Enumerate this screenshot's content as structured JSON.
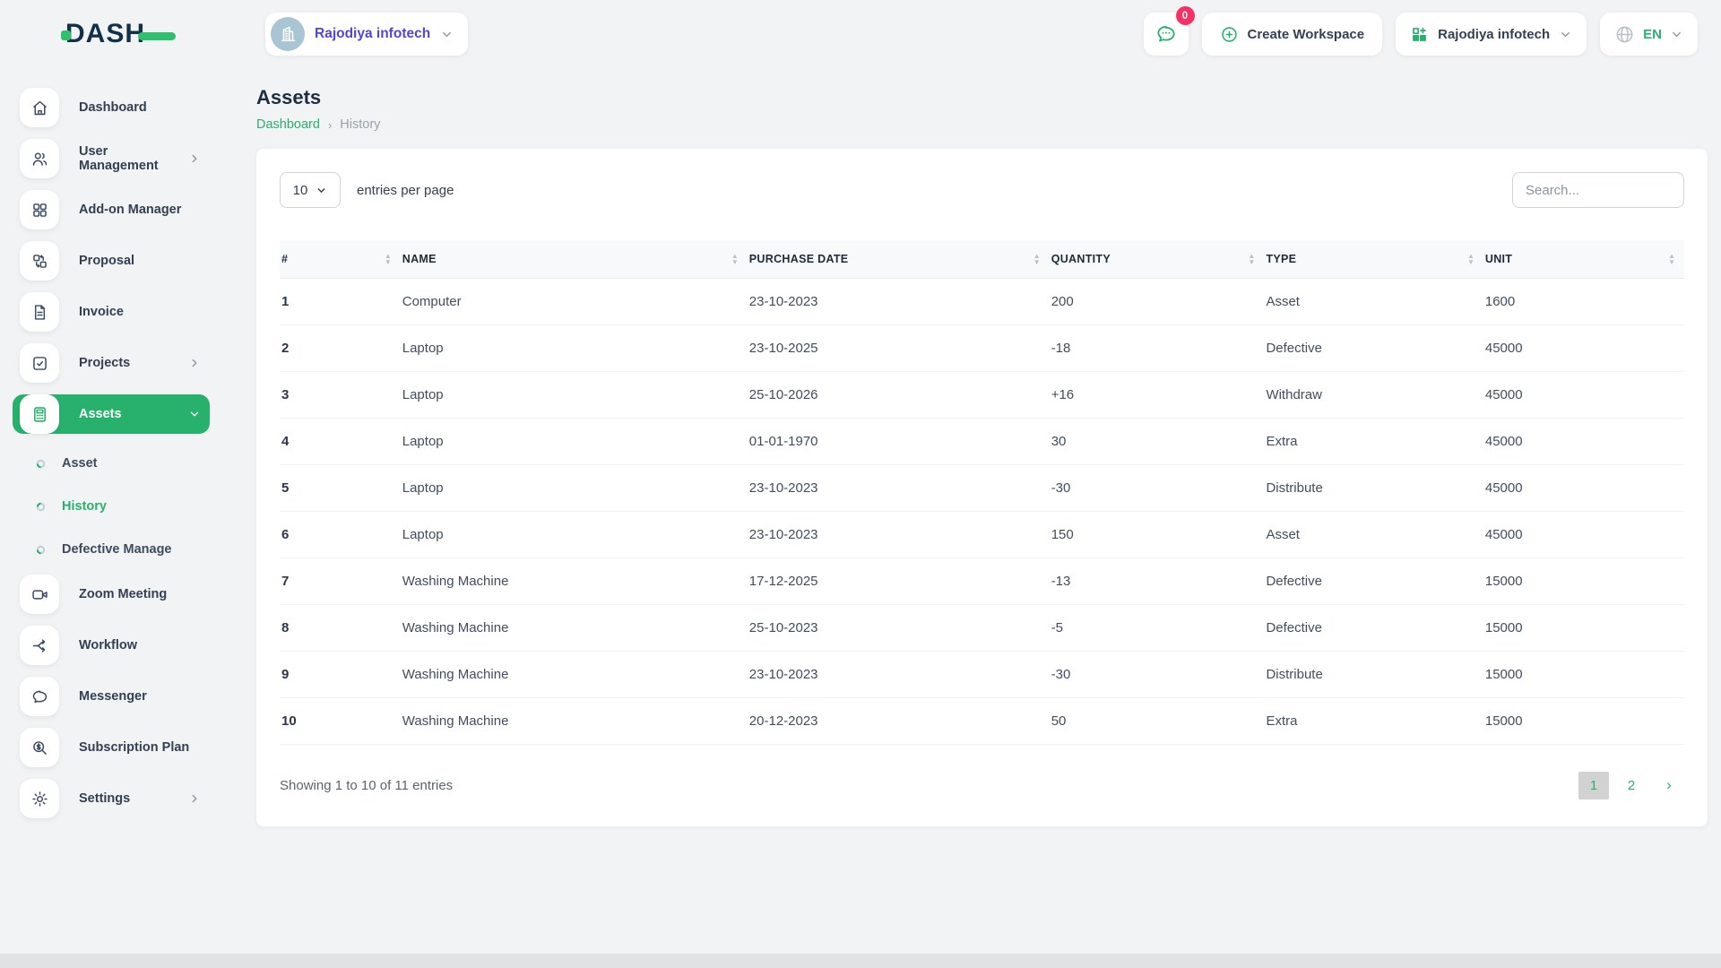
{
  "brand": {
    "logo_text": "DASH"
  },
  "topbar": {
    "workspace_selector": {
      "label": "Rajodiya infotech"
    },
    "messages_badge": "0",
    "create_workspace_label": "Create Workspace",
    "company_dropdown_label": "Rajodiya infotech",
    "language_code": "EN"
  },
  "sidebar": {
    "items": [
      {
        "label": "Dashboard"
      },
      {
        "label": "User Management"
      },
      {
        "label": "Add-on Manager"
      },
      {
        "label": "Proposal"
      },
      {
        "label": "Invoice"
      },
      {
        "label": "Projects"
      },
      {
        "label": "Assets"
      },
      {
        "label": "Zoom Meeting"
      },
      {
        "label": "Workflow"
      },
      {
        "label": "Messenger"
      },
      {
        "label": "Subscription Plan"
      },
      {
        "label": "Settings"
      }
    ],
    "assets_submenu": [
      {
        "label": "Asset"
      },
      {
        "label": "History"
      },
      {
        "label": "Defective Manage"
      }
    ]
  },
  "page": {
    "title": "Assets",
    "breadcrumb": {
      "home": "Dashboard",
      "separator": "›",
      "current": "History"
    }
  },
  "table_card": {
    "entries_select_value": "10",
    "entries_per_page_label": "entries per page",
    "search_placeholder": "Search...",
    "columns": [
      "#",
      "NAME",
      "PURCHASE DATE",
      "QUANTITY",
      "TYPE",
      "UNIT"
    ],
    "rows": [
      [
        "1",
        "Computer",
        "23-10-2023",
        "200",
        "Asset",
        "1600"
      ],
      [
        "2",
        "Laptop",
        "23-10-2025",
        "-18",
        "Defective",
        "45000"
      ],
      [
        "3",
        "Laptop",
        "25-10-2026",
        "+16",
        "Withdraw",
        "45000"
      ],
      [
        "4",
        "Laptop",
        "01-01-1970",
        "30",
        "Extra",
        "45000"
      ],
      [
        "5",
        "Laptop",
        "23-10-2023",
        "-30",
        "Distribute",
        "45000"
      ],
      [
        "6",
        "Laptop",
        "23-10-2023",
        "150",
        "Asset",
        "45000"
      ],
      [
        "7",
        "Washing Machine",
        "17-12-2025",
        "-13",
        "Defective",
        "15000"
      ],
      [
        "8",
        "Washing Machine",
        "25-10-2023",
        "-5",
        "Defective",
        "15000"
      ],
      [
        "9",
        "Washing Machine",
        "23-10-2023",
        "-30",
        "Distribute",
        "15000"
      ],
      [
        "10",
        "Washing Machine",
        "20-12-2023",
        "50",
        "Extra",
        "15000"
      ]
    ],
    "footer": {
      "showing_text": "Showing 1 to 10 of 11 entries",
      "pagination": {
        "page1": "1",
        "page2": "2",
        "next": "›",
        "active_page": "1"
      }
    }
  },
  "colors": {
    "accent_green": "#28b16d",
    "logo_green": "#2fc06e",
    "link_purple": "#5146d8",
    "badge_pink": "#f73164",
    "navy": "#123149",
    "active_page_bg": "#d2d2d2"
  }
}
